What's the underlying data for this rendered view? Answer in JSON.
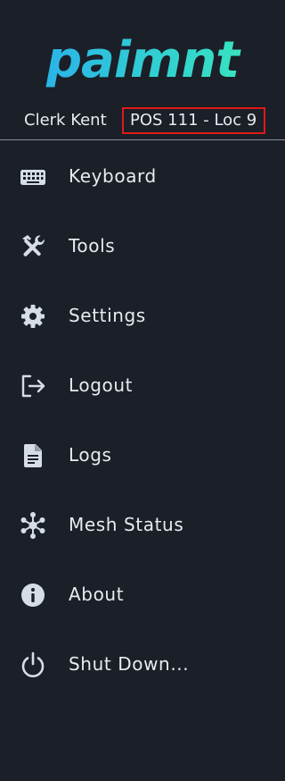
{
  "app": {
    "logo_text": "paimnt"
  },
  "user": {
    "name": "Clerk Kent",
    "terminal": "POS 111 - Loc 9"
  },
  "menu": {
    "items": [
      {
        "label": "Keyboard",
        "icon": "keyboard-icon"
      },
      {
        "label": "Tools",
        "icon": "tools-icon"
      },
      {
        "label": "Settings",
        "icon": "gear-icon"
      },
      {
        "label": "Logout",
        "icon": "logout-icon"
      },
      {
        "label": "Logs",
        "icon": "document-icon"
      },
      {
        "label": "Mesh Status",
        "icon": "mesh-network-icon"
      },
      {
        "label": "About",
        "icon": "info-icon"
      },
      {
        "label": "Shut Down...",
        "icon": "power-icon"
      }
    ]
  },
  "colors": {
    "background": "#1a1f28",
    "text": "#e8ebef",
    "icon": "#d6dde6",
    "highlight_border": "#e01818",
    "logo_gradient_start": "#2ab4e8",
    "logo_gradient_end": "#38e3c0"
  }
}
